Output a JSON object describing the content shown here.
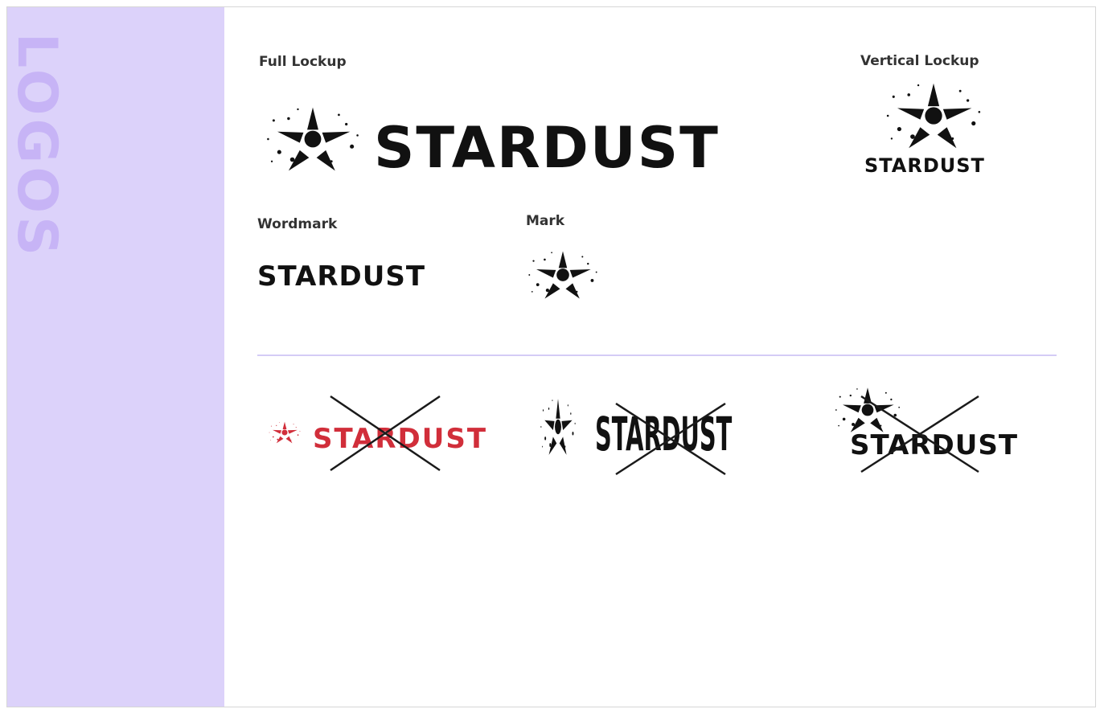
{
  "section": {
    "vertical_title": "LOGOS"
  },
  "labels": {
    "full_lockup": "Full Lockup",
    "vertical_lockup": "Vertical Lockup",
    "wordmark": "Wordmark",
    "mark": "Mark"
  },
  "brand": {
    "name": "STARDUST"
  },
  "colors": {
    "sidebar": "#dcd2fa",
    "sidebar_title": "#c7b4f6",
    "logo": "#111111",
    "incorrect_color_example": "#d12e3a",
    "divider": "#d4ccf6"
  },
  "icons": {
    "mark": "stardust-star-icon",
    "cross": "cross-out-icon"
  }
}
